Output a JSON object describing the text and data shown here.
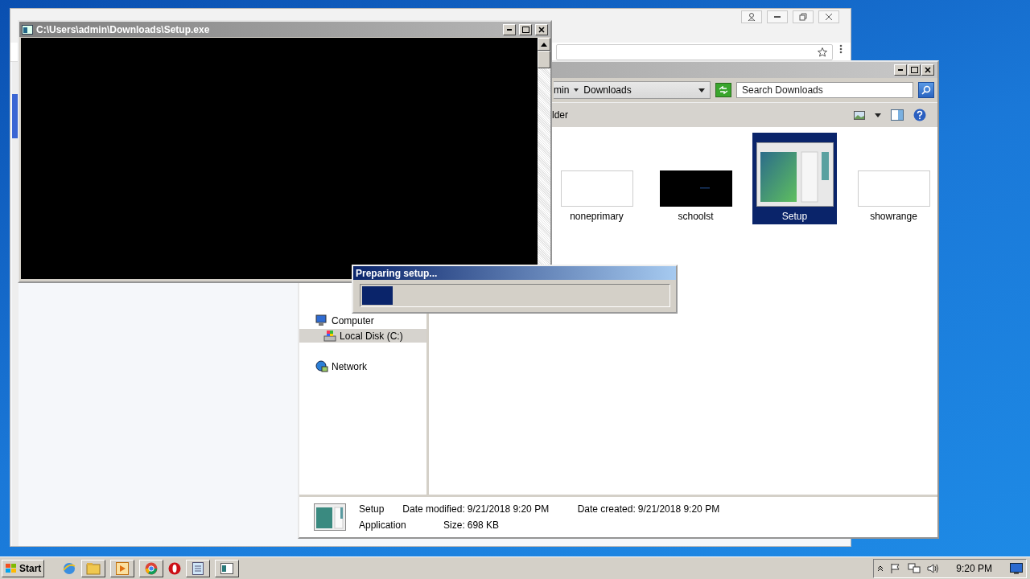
{
  "console_window": {
    "title": "C:\\Users\\admin\\Downloads\\Setup.exe"
  },
  "explorer": {
    "address_path": [
      "min",
      "Downloads"
    ],
    "search": {
      "placeholder": "Search Downloads"
    },
    "toolbar_label": "lder",
    "nav_items": [
      {
        "label": "Computer",
        "kind": "computer",
        "selected": false,
        "children": [
          {
            "label": "Local Disk (C:)",
            "kind": "drive",
            "selected": true
          }
        ]
      },
      {
        "label": "Network",
        "kind": "network",
        "selected": false
      }
    ],
    "files": [
      {
        "name": "noneprimary",
        "kind": "blank",
        "selected": false
      },
      {
        "name": "schoolst",
        "kind": "dark",
        "selected": false
      },
      {
        "name": "Setup",
        "kind": "app",
        "selected": true
      },
      {
        "name": "showrange",
        "kind": "blank",
        "selected": false
      }
    ],
    "details": {
      "name": "Setup",
      "type": "Application",
      "fields": [
        {
          "label": "Date modified:",
          "value": "9/21/2018 9:20 PM"
        },
        {
          "label": "Size:",
          "value": "698 KB"
        },
        {
          "label": "Date created:",
          "value": "9/21/2018 9:20 PM"
        }
      ]
    }
  },
  "setup_dialog": {
    "title": "Preparing setup...",
    "level": 0.1
  },
  "taskbar": {
    "start_label": "Start",
    "clock": "9:20 PM"
  }
}
